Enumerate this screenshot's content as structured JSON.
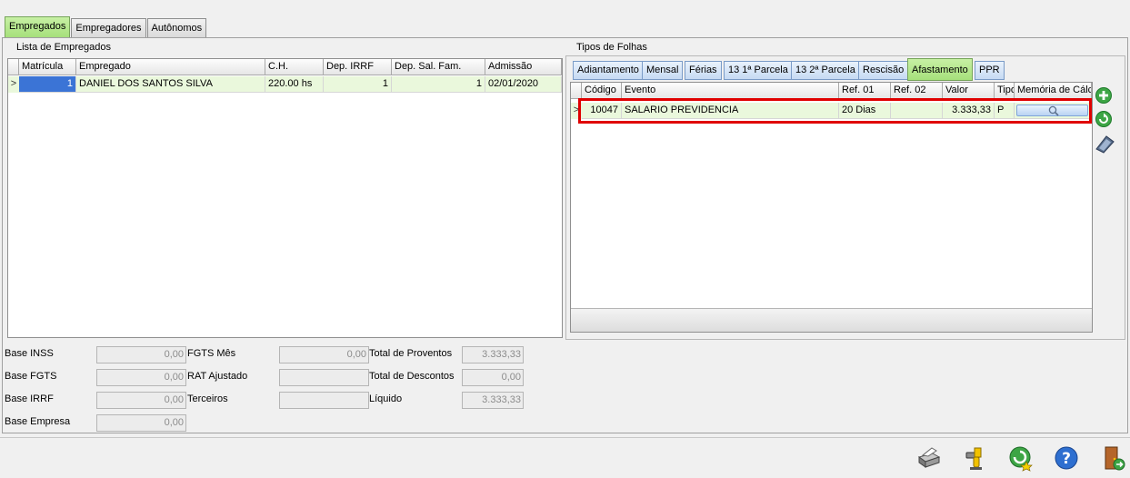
{
  "top_tabs": [
    {
      "label": "Empregados",
      "active": true
    },
    {
      "label": "Empregadores",
      "active": false
    },
    {
      "label": "Autônomos",
      "active": false
    }
  ],
  "employees": {
    "title": "Lista de Empregados",
    "columns": [
      "Matrícula",
      "Empregado",
      "C.H.",
      "Dep. IRRF",
      "Dep. Sal. Fam.",
      "Admissão"
    ],
    "rows": [
      {
        "matricula": "1",
        "empregado": "DANIEL DOS SANTOS SILVA",
        "ch": "220.00 hs",
        "dep_irrf": "1",
        "dep_sal_fam": "1",
        "admissao": "02/01/2020"
      }
    ]
  },
  "payroll": {
    "title": "Tipos de Folhas",
    "tabs": [
      "Adiantamento",
      "Mensal",
      "Férias",
      "13 1ª Parcela",
      "13 2ª Parcela",
      "Rescisão",
      "Afastamento",
      "PPR"
    ],
    "active_tab": "Afastamento",
    "columns": [
      "Código",
      "Evento",
      "Ref. 01",
      "Ref. 02",
      "Valor",
      "Tipo",
      "Memória de Cálc"
    ],
    "rows": [
      {
        "codigo": "10047",
        "evento": "SALARIO PREVIDENCIA",
        "ref01": "20 Dias",
        "ref02": "",
        "valor": "3.333,33",
        "tipo": "P"
      }
    ]
  },
  "totals": {
    "base_inss_label": "Base INSS",
    "base_inss": "0,00",
    "base_fgts_label": "Base FGTS",
    "base_fgts": "0,00",
    "base_irrf_label": "Base IRRF",
    "base_irrf": "0,00",
    "base_empresa_label": "Base Empresa",
    "base_empresa": "0,00",
    "fgts_mes_label": "FGTS Mês",
    "fgts_mes": "0,00",
    "rat_label": "RAT Ajustado",
    "rat": "",
    "terceiros_label": "Terceiros",
    "terceiros": "",
    "total_proventos_label": "Total de Proventos",
    "total_proventos": "3.333,33",
    "total_descontos_label": "Total de Descontos",
    "total_descontos": "0,00",
    "liquido_label": "Líquido",
    "liquido": "3.333,33"
  },
  "side_icons": [
    "add-icon",
    "refresh-icon",
    "calculator-icon"
  ],
  "toolbar_icons": [
    "printer-icon",
    "tools-icon",
    "favorite-refresh-icon",
    "help-icon",
    "exit-door-icon"
  ],
  "colors": {
    "active_tab": "#a6e07b",
    "highlight_box": "#e00000",
    "row_selected": "#eaf8dc"
  }
}
